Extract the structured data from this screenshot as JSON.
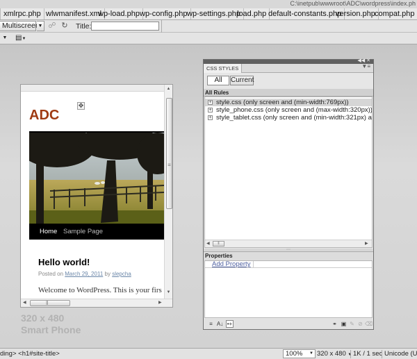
{
  "path_bar": {
    "path": "C:\\inetpub\\wwwroot\\ADC\\wordpress\\index.ph"
  },
  "related_files": [
    {
      "label": "xmlrpc.php"
    },
    {
      "label": "wlwmanifest.xml"
    },
    {
      "label": "wp-load.php"
    },
    {
      "label": "wp-config.php"
    },
    {
      "label": "wp-settings.php"
    },
    {
      "label": "load.php"
    },
    {
      "label": "default-constants.php"
    },
    {
      "label": "version.php"
    },
    {
      "label": "compat.php"
    }
  ],
  "toolbar": {
    "multiscreen_label": "Multiscreen",
    "title_label": "Title:",
    "title_value": ""
  },
  "device_preview": {
    "site_title": "ADC",
    "nav_items": [
      {
        "label": "Home"
      },
      {
        "label": "Sample Page"
      }
    ],
    "post_title": "Hello world!",
    "posted_on": "Posted on",
    "post_date": "March 29, 2011",
    "by": "by",
    "author": "slepcha",
    "excerpt": "Welcome to WordPress. This is your firs"
  },
  "device_size": {
    "dimensions": "320 x 480",
    "name": "Smart Phone"
  },
  "css_panel": {
    "tab_title": "CSS STYLES",
    "mode_all": "All",
    "mode_current": "Current",
    "rules_header": "All Rules",
    "rules": [
      {
        "label": "style.css (only screen and (min-width:769px))"
      },
      {
        "label": "style_phone.css (only screen and (max-width:320px))"
      },
      {
        "label": "style_tablet.css (only screen and (min-width:321px) and"
      }
    ],
    "properties_header": "Properties",
    "add_property": "Add Property"
  },
  "status_bar": {
    "tag_path": "ding> <h1#site-title>",
    "zoom": "100%",
    "window_size": "320 x 480",
    "download_time": "1K / 1 sec",
    "encoding": "Unicode (UT"
  },
  "colors": {
    "site_title": "#9f3a12",
    "nav_bar": "#000000",
    "link": "#6a86a8"
  }
}
